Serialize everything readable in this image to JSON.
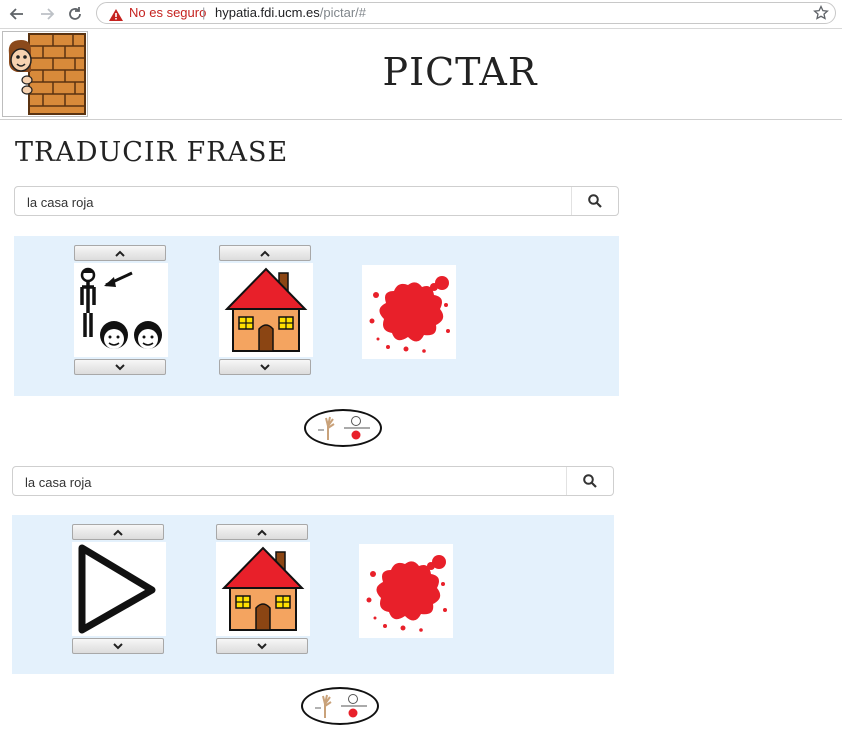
{
  "browser": {
    "security_label": "No es seguro",
    "separator": "|",
    "url_host": "hypatia.fdi.ucm.es",
    "url_path": "/pictar/#"
  },
  "app": {
    "title": "PICTAR"
  },
  "section": {
    "title": "TRADUCIR FRASE"
  },
  "translations": [
    {
      "query": "la casa roja",
      "pictograms": [
        {
          "word": "la",
          "icon": "girls-pictogram-icon",
          "has_arrows": true
        },
        {
          "word": "casa",
          "icon": "house-pictogram-icon",
          "has_arrows": true
        },
        {
          "word": "roja",
          "icon": "red-splash-pictogram-icon",
          "has_arrows": false
        }
      ]
    },
    {
      "query": "la casa roja",
      "pictograms": [
        {
          "word": "la",
          "icon": "play-triangle-pictogram-icon",
          "has_arrows": true
        },
        {
          "word": "casa",
          "icon": "house-pictogram-icon",
          "has_arrows": true
        },
        {
          "word": "roja",
          "icon": "red-splash-pictogram-icon",
          "has_arrows": false
        }
      ]
    }
  ],
  "colors": {
    "panel_bg": "#e4f1fc",
    "insecure_red": "#c5221f",
    "house_roof": "#e8202a",
    "house_wall": "#f4a460",
    "splash": "#e8202a"
  }
}
